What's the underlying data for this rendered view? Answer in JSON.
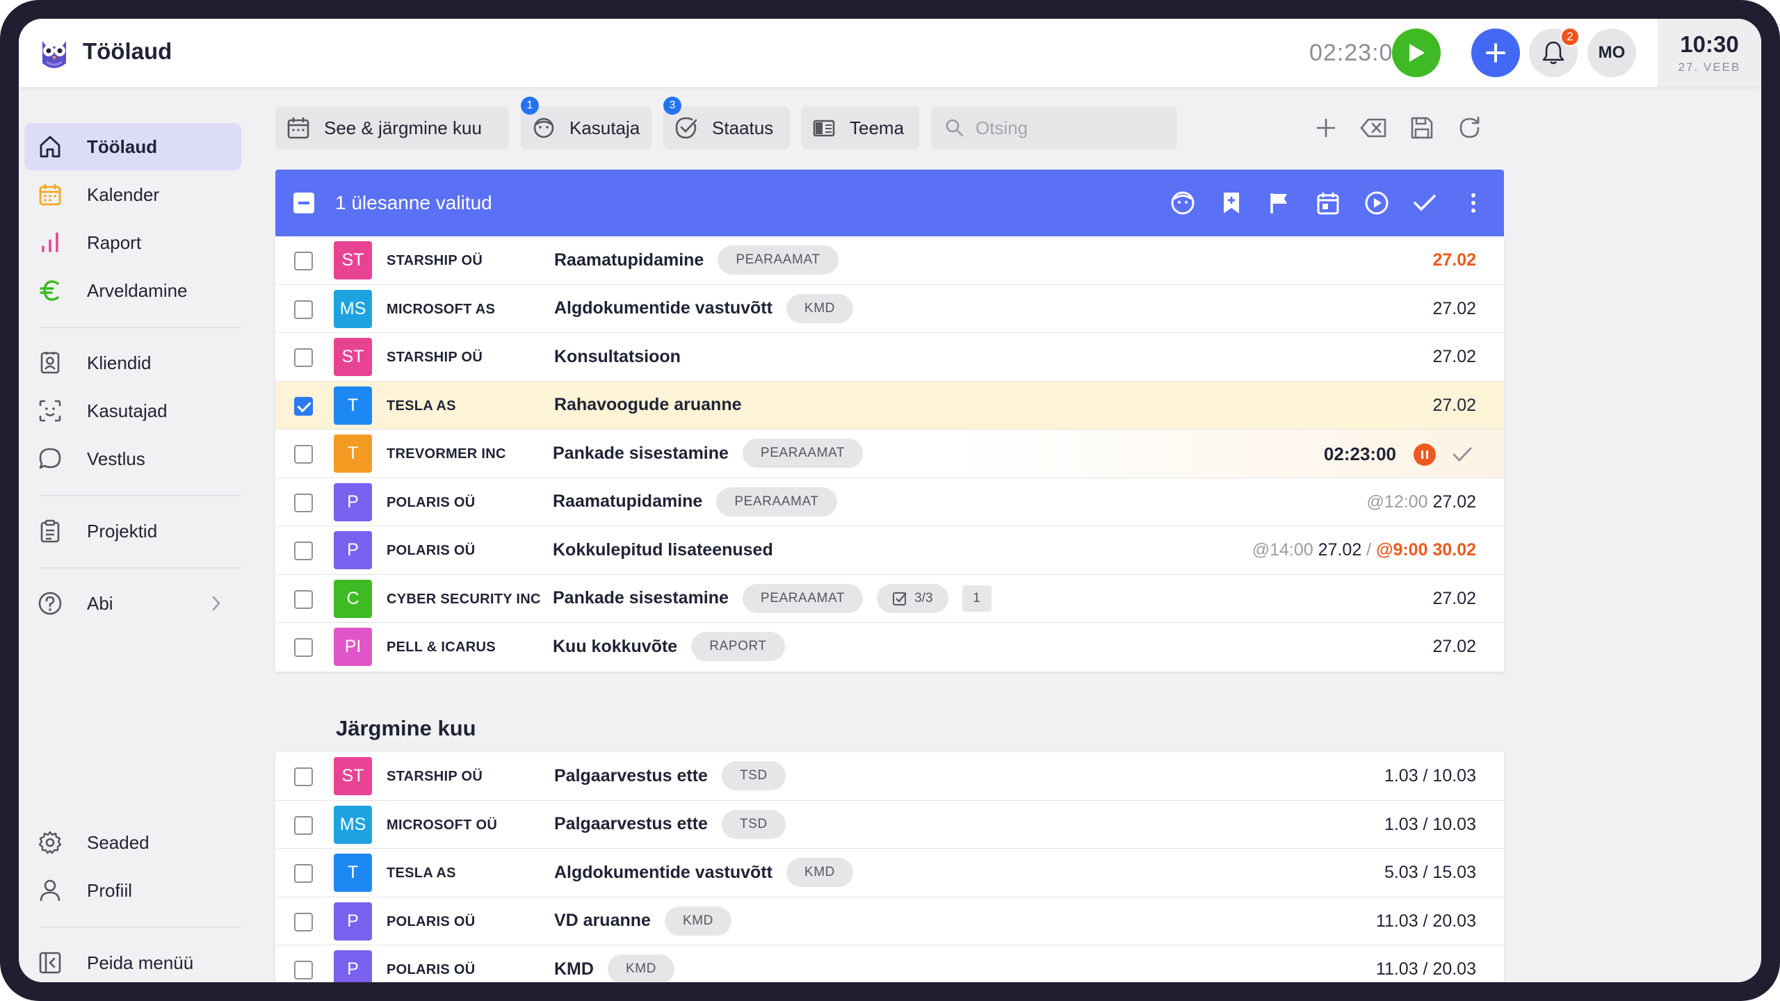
{
  "app": {
    "title": "Töölaud",
    "timer": "02:23:00",
    "notifications_count": "2",
    "user_initials": "MO",
    "clock_time": "10:30",
    "clock_date": "27. VEEB"
  },
  "sidebar": {
    "items": [
      {
        "label": "Töölaud",
        "icon": "home-icon",
        "active": true
      },
      {
        "label": "Kalender",
        "icon": "calendar-icon"
      },
      {
        "label": "Raport",
        "icon": "bar-chart-icon"
      },
      {
        "label": "Arveldamine",
        "icon": "euro-icon"
      },
      {
        "label": "Kliendid",
        "icon": "contacts-icon"
      },
      {
        "label": "Kasutajad",
        "icon": "face-scan-icon"
      },
      {
        "label": "Vestlus",
        "icon": "chat-icon"
      },
      {
        "label": "Projektid",
        "icon": "clipboard-icon"
      },
      {
        "label": "Abi",
        "icon": "help-icon"
      },
      {
        "label": "Seaded",
        "icon": "gear-icon"
      },
      {
        "label": "Profiil",
        "icon": "user-icon"
      },
      {
        "label": "Peida menüü",
        "icon": "collapse-icon"
      }
    ]
  },
  "filters": {
    "period": "See & järgmine kuu",
    "user": "Kasutaja",
    "user_badge": "1",
    "status": "Staatus",
    "status_badge": "3",
    "topic": "Teema",
    "search_placeholder": "Otsing"
  },
  "selection": {
    "label": "1 ülesanne valitud"
  },
  "colors": {
    "accent": "#5a70f5",
    "play": "#3fba24",
    "add": "#4369f4",
    "overdue": "#ec5a1e",
    "selected_row": "#fdf3d6"
  },
  "current_tasks": [
    {
      "initials": "ST",
      "color": "#e84393",
      "client": "STARSHIP OÜ",
      "task": "Raamatupidamine",
      "tag": "PEARAAMAT",
      "date": "27.02",
      "overdue": true
    },
    {
      "initials": "MS",
      "color": "#1fa3e0",
      "client": "MICROSOFT AS",
      "task": "Algdokumentide vastuvõtt",
      "tag": "KMD",
      "date": "27.02"
    },
    {
      "initials": "ST",
      "color": "#e84393",
      "client": "STARSHIP OÜ",
      "task": "Konsultatsioon",
      "date": "27.02"
    },
    {
      "initials": "T",
      "color": "#1e88f2",
      "client": "TESLA AS",
      "task": "Rahavoogude aruanne",
      "date": "27.02",
      "checked": true
    },
    {
      "initials": "T",
      "color": "#f59a23",
      "client": "TREVORMER INC",
      "task": "Pankade sisestamine",
      "tag": "PEARAAMAT",
      "running": true,
      "run_timer": "02:23:00"
    },
    {
      "initials": "P",
      "color": "#7b61f0",
      "client": "POLARIS OÜ",
      "task": "Raamatupidamine",
      "tag": "PEARAAMAT",
      "time": "@12:00",
      "date": "27.02"
    },
    {
      "initials": "P",
      "color": "#7b61f0",
      "client": "POLARIS OÜ",
      "task": "Kokkulepitud lisateenused",
      "time": "@14:00",
      "date": "27.02",
      "sep": "/",
      "due": "@9:00 30.02"
    },
    {
      "initials": "C",
      "color": "#3fba24",
      "client": "CYBER SECURITY INC",
      "task": "Pankade sisestamine",
      "tag": "PEARAAMAT",
      "checklist": "3/3",
      "comments": "1",
      "date": "27.02"
    },
    {
      "initials": "PI",
      "color": "#e056c8",
      "client": "PELL & ICARUS",
      "task": "Kuu kokkuvõte",
      "tag": "RAPORT",
      "date": "27.02"
    }
  ],
  "next_section_title": "Järgmine kuu",
  "next_tasks": [
    {
      "initials": "ST",
      "color": "#e84393",
      "client": "STARSHIP OÜ",
      "task": "Palgaarvestus ette",
      "tag": "TSD",
      "date": "1.03 / 10.03"
    },
    {
      "initials": "MS",
      "color": "#1fa3e0",
      "client": "MICROSOFT OÜ",
      "task": "Palgaarvestus ette",
      "tag": "TSD",
      "date": "1.03 / 10.03"
    },
    {
      "initials": "T",
      "color": "#1e88f2",
      "client": "TESLA AS",
      "task": "Algdokumentide vastuvõtt",
      "tag": "KMD",
      "date": "5.03 / 15.03"
    },
    {
      "initials": "P",
      "color": "#7b61f0",
      "client": "POLARIS OÜ",
      "task": "VD aruanne",
      "tag": "KMD",
      "date": "11.03 / 20.03"
    },
    {
      "initials": "P",
      "color": "#7b61f0",
      "client": "POLARIS OÜ",
      "task": "KMD",
      "tag": "KMD",
      "date": "11.03 / 20.03"
    }
  ]
}
